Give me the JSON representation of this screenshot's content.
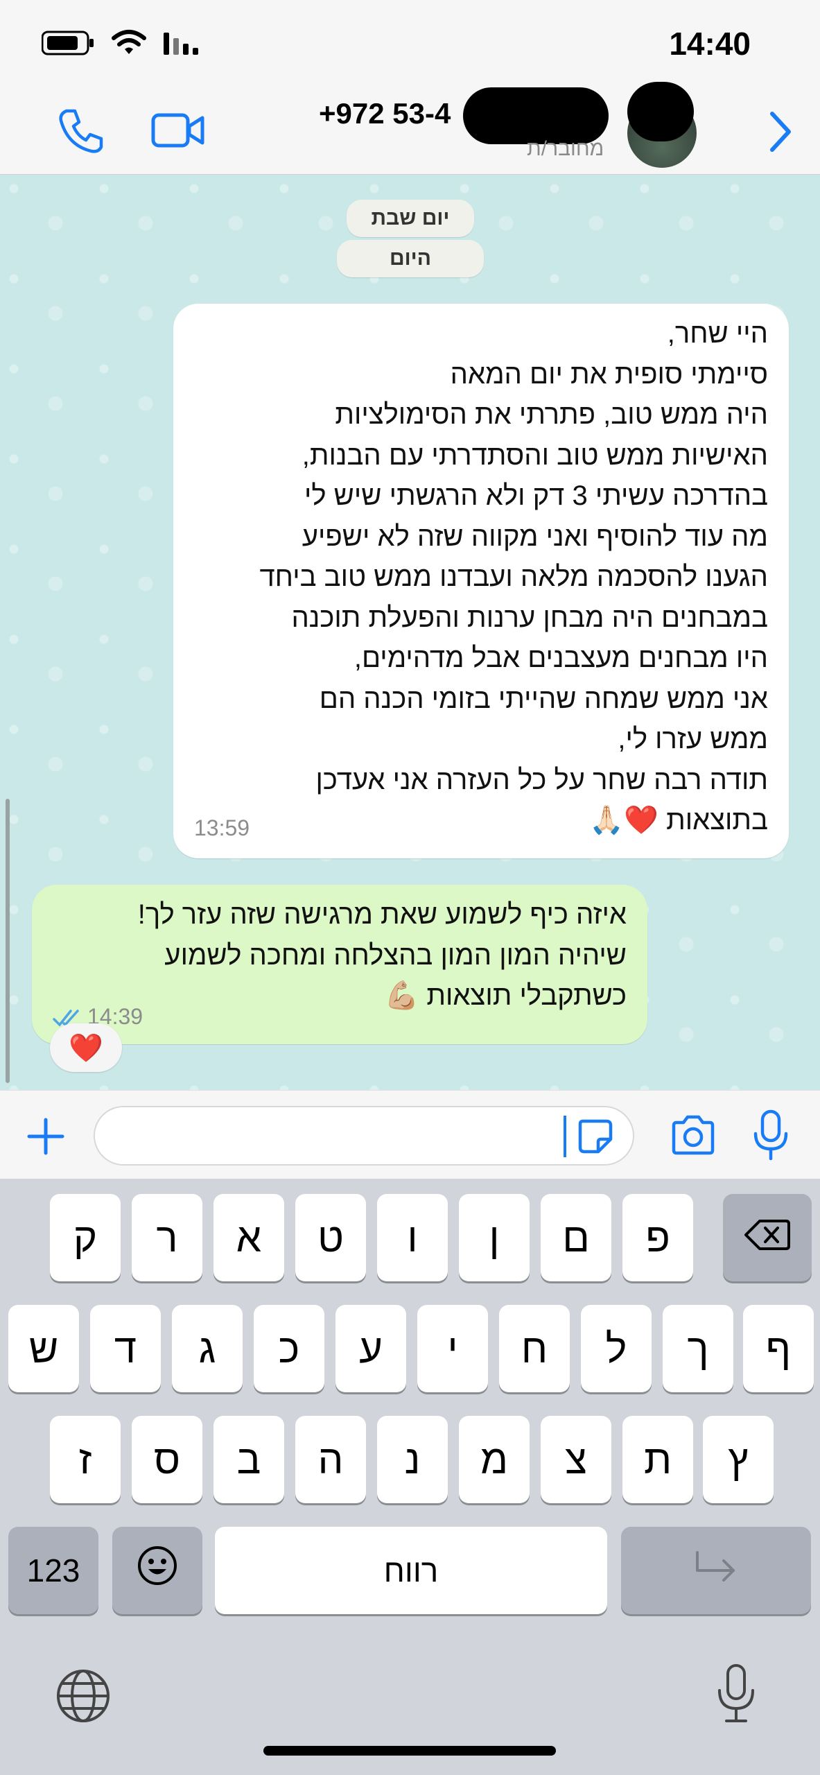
{
  "status_bar": {
    "time": "14:40"
  },
  "header": {
    "contact_name": "+972 53-4",
    "contact_status": "מחובר/ת",
    "icons": [
      "phone-icon",
      "video-icon",
      "chevron-right-icon"
    ]
  },
  "chat": {
    "date_labels": [
      "יום שבת",
      "היום"
    ],
    "incoming": {
      "lines": [
        "היי שחר,",
        "סיימתי סופית את יום המאה",
        "היה ממש טוב, פתרתי את הסימולציות",
        "האישיות ממש טוב והסתדרתי עם הבנות,",
        "בהדרכה עשיתי 3 דק ולא הרגשתי שיש לי",
        "מה עוד להוסיף ואני מקווה שזה לא ישפיע",
        "הגענו להסכמה מלאה ועבדנו ממש טוב ביחד",
        "במבחנים היה מבחן ערנות והפעלת תוכנה",
        "היו מבחנים מעצבנים אבל מדהימים,",
        "אני ממש שמחה שהייתי בזומי הכנה הם",
        "ממש עזרו לי,",
        "תודה רבה שחר על כל העזרה אני אעדכן",
        "בתוצאות ❤️🙏🏻"
      ],
      "time": "13:59"
    },
    "outgoing": {
      "lines": [
        "איזה כיף לשמוע שאת מרגישה שזה עזר לך!",
        "שיהיה המון המון בהצלחה ומחכה לשמוע",
        "כשתקבלי תוצאות 💪🏼"
      ],
      "time": "14:39",
      "reaction": "❤️"
    }
  },
  "input": {
    "placeholder": ""
  },
  "keyboard": {
    "row1": [
      "ק",
      "ר",
      "א",
      "ט",
      "ו",
      "ן",
      "ם",
      "פ"
    ],
    "row2": [
      "ש",
      "ד",
      "ג",
      "כ",
      "ע",
      "י",
      "ח",
      "ל",
      "ך",
      "ף"
    ],
    "row3": [
      "ז",
      "ס",
      "ב",
      "ה",
      "נ",
      "מ",
      "צ",
      "ת",
      "ץ"
    ],
    "numbers_key": "123",
    "space_key": "רווח"
  }
}
